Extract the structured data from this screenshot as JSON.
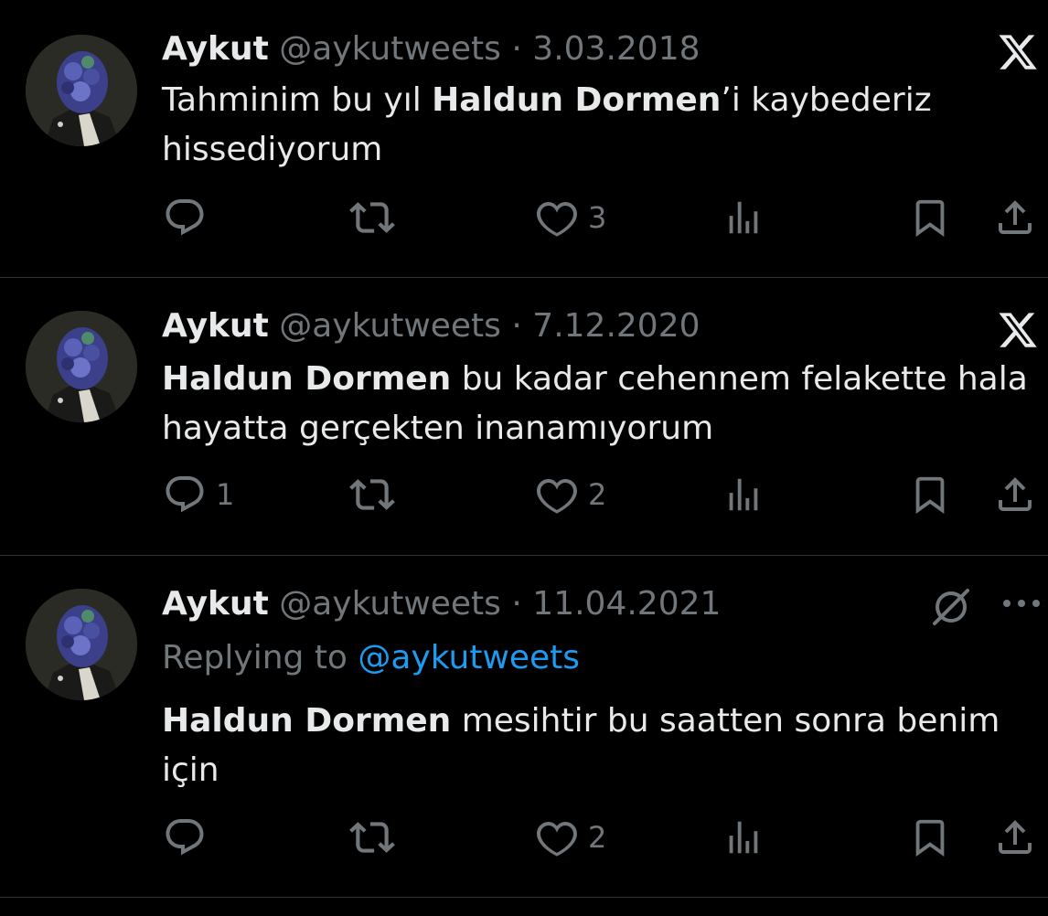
{
  "colors": {
    "background": "#000000",
    "text": "#e7e9ea",
    "muted": "#71767b",
    "accent": "#1d9bf0",
    "divider": "#2f3336"
  },
  "tweets": [
    {
      "name": "Aykut",
      "handle": "@aykutweets",
      "sep": "·",
      "date": "3.03.2018",
      "text_pre": "Tahminim bu yıl ",
      "text_bold": "Haldun Dormen",
      "text_post": "’i kaybederiz hissediyorum",
      "corner_icon": "x-logo-icon",
      "replies": "",
      "retweets": "",
      "likes": "3"
    },
    {
      "name": "Aykut",
      "handle": "@aykutweets",
      "sep": "·",
      "date": "7.12.2020",
      "text_pre": "",
      "text_bold": "Haldun Dormen",
      "text_post": " bu kadar cehennem felakette hala hayatta gerçekten inanamıyorum",
      "corner_icon": "x-logo-icon",
      "replies": "1",
      "retweets": "",
      "likes": "2"
    },
    {
      "name": "Aykut",
      "handle": "@aykutweets",
      "sep": "·",
      "date": "11.04.2021",
      "replying_prefix": "Replying to ",
      "replying_to": "@aykutweets",
      "text_pre": "",
      "text_bold": "Haldun Dormen",
      "text_post": " mesihtir bu saatten sonra benim için",
      "corner_icon": "grok-icon",
      "more_icon": "more-dots-icon",
      "replies": "",
      "retweets": "",
      "likes": "2"
    }
  ],
  "icons": {
    "reply": "reply-icon",
    "retweet": "retweet-icon",
    "like": "heart-icon",
    "views": "views-icon",
    "bookmark": "bookmark-icon",
    "share": "share-icon"
  }
}
